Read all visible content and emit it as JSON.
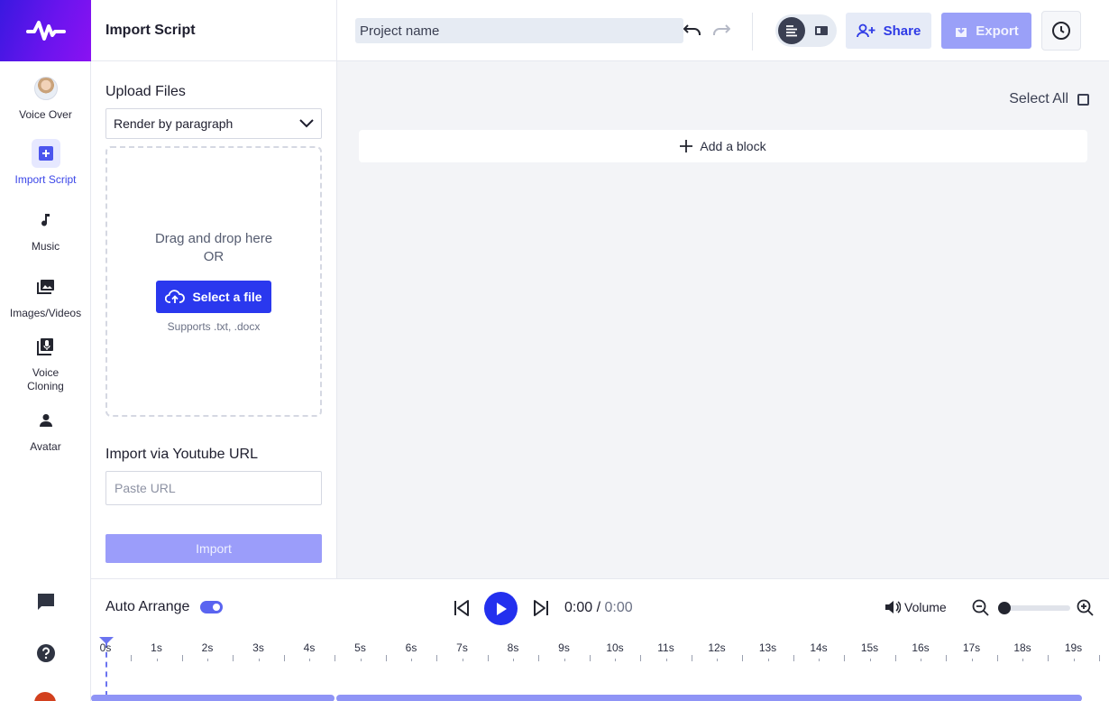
{
  "sidebar": {
    "items": [
      {
        "label": "Voice Over",
        "icon": "voice-avatar-icon"
      },
      {
        "label": "Import Script",
        "icon": "plus-square-icon"
      },
      {
        "label": "Music",
        "icon": "music-note-icon"
      },
      {
        "label": "Images/Videos",
        "icon": "image-library-icon"
      },
      {
        "label": "Voice Cloning",
        "icon": "voice-clone-icon"
      },
      {
        "label": "Avatar",
        "icon": "person-icon"
      }
    ],
    "bottom_icons": [
      "chat-icon",
      "help-icon",
      "user-avatar-icon"
    ]
  },
  "panel": {
    "title": "Import Script",
    "upload_title": "Upload Files",
    "render_select": "Render by paragraph",
    "drop_text": "Drag and drop here",
    "or_text": "OR",
    "select_file_label": "Select a file",
    "supports_text": "Supports .txt, .docx",
    "youtube_title": "Import via Youtube URL",
    "url_placeholder": "Paste URL",
    "import_label": "Import"
  },
  "topbar": {
    "project_name": "Project name",
    "share_label": "Share",
    "export_label": "Export"
  },
  "main": {
    "select_all_label": "Select All",
    "add_block_label": "Add a block"
  },
  "player": {
    "auto_arrange_label": "Auto Arrange",
    "auto_arrange_on": true,
    "current_time": "0:00",
    "separator": " / ",
    "total_time": "0:00",
    "volume_label": "Volume",
    "zoom_level": 0
  },
  "timeline": {
    "ticks": [
      "0s",
      "1s",
      "2s",
      "3s",
      "4s",
      "5s",
      "6s",
      "7s",
      "8s",
      "9s",
      "10s",
      "11s",
      "12s",
      "13s",
      "14s",
      "15s",
      "16s",
      "17s",
      "18s",
      "19s"
    ]
  },
  "colors": {
    "accent": "#2330ee",
    "brand_gradient_start": "#3a18e0",
    "brand_gradient_end": "#8a12f2",
    "export_disabled": "#9aa0f8"
  }
}
